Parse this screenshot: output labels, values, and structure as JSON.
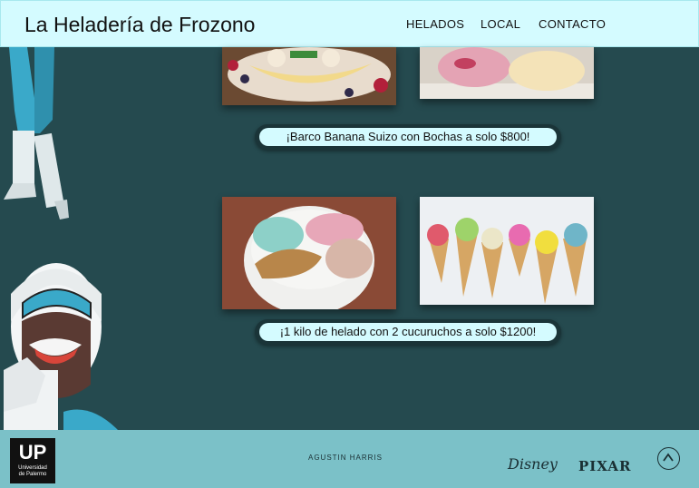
{
  "header": {
    "logo": "La Heladería de Frozono",
    "nav": [
      "HELADOS",
      "LOCAL",
      "CONTACTO"
    ]
  },
  "promos": [
    "¡Barco Banana Suizo con Bochas a solo $800!",
    "¡1 kilo de helado con 2 cucuruchos a solo $1200!"
  ],
  "footer": {
    "logo_big": "UP",
    "logo_small_line1": "Universidad",
    "logo_small_line2": "de Palermo",
    "credit": "AGUSTIN HARRIS",
    "brand_disney": "Disney",
    "brand_pixar": "PIXAR"
  },
  "colors": {
    "background": "#254a4f",
    "header": "#d4fbff",
    "footer": "#7bc1c8"
  },
  "icons": [
    "scroll-to-top-icon"
  ]
}
